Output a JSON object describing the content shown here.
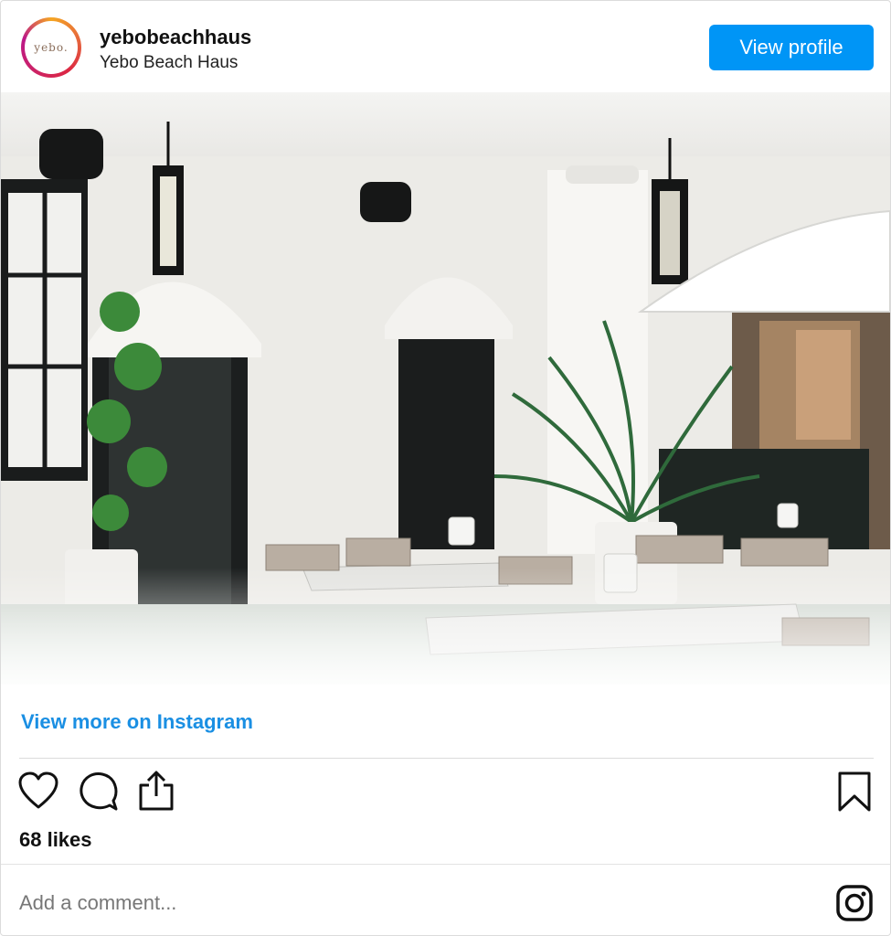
{
  "post": {
    "avatar_text": "yebo.",
    "username": "yebobeachhaus",
    "full_name": "Yebo Beach Haus",
    "view_profile_label": "View profile",
    "image_alt": "Yebo Beach Haus patio with white arches, pendant lanterns, palms, and marble tables",
    "view_more_label": "View more on Instagram",
    "likes_text": "68 likes",
    "comment_placeholder": "Add a comment..."
  },
  "icons": {
    "like": "heart-icon",
    "comment": "comment-icon",
    "share": "share-icon",
    "save": "bookmark-icon",
    "instagram": "instagram-icon"
  },
  "colors": {
    "accent": "#0095f6",
    "link": "#1a8fe3",
    "text": "#111111",
    "muted": "#777777",
    "divider": "#dbdbdb"
  }
}
